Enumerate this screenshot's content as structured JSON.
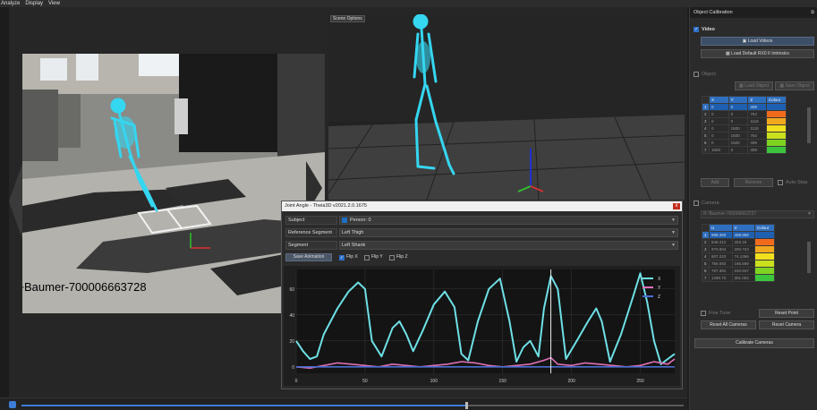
{
  "menu": [
    "Analyze",
    "Display",
    "View"
  ],
  "scene": {
    "options_label": "Scene Options"
  },
  "video": {
    "camera_overlay": "R~Baumer-700006663728"
  },
  "dialog": {
    "title": "Joint Angle - Theia3D v2021.2.0.1675",
    "close": "x",
    "subject_label": "Subject",
    "subject_value": "Person: 0",
    "ref_label": "Reference Segment",
    "ref_value": "Left Thigh",
    "segment_label": "Segment",
    "segment_value": "Left Shank",
    "save_animation": "Save Animation",
    "flip_x": "Flip X",
    "flip_y": "Flip Y",
    "flip_z": "Flip Z"
  },
  "chart_data": {
    "type": "line",
    "xlim": [
      0,
      275
    ],
    "ylim": [
      -5,
      75
    ],
    "xticks": [
      0,
      50,
      100,
      150,
      200,
      250
    ],
    "yticks": [
      0,
      20,
      40,
      60
    ],
    "vline_x": 185,
    "legend_position": "top-right",
    "series": [
      {
        "name": "X",
        "color": "#6ee0e6",
        "x": [
          0,
          5,
          10,
          15,
          20,
          30,
          38,
          45,
          50,
          55,
          62,
          70,
          75,
          80,
          85,
          92,
          100,
          108,
          115,
          120,
          125,
          132,
          140,
          148,
          155,
          160,
          165,
          170,
          176,
          180,
          185,
          190,
          196,
          205,
          212,
          218,
          222,
          228,
          236,
          245,
          250,
          255,
          260,
          265,
          270,
          275
        ],
        "y": [
          20,
          12,
          6,
          8,
          25,
          45,
          58,
          65,
          60,
          20,
          8,
          30,
          35,
          25,
          12,
          28,
          48,
          58,
          46,
          10,
          5,
          35,
          60,
          68,
          35,
          4,
          15,
          20,
          8,
          45,
          70,
          60,
          6,
          22,
          35,
          45,
          35,
          4,
          25,
          55,
          72,
          50,
          20,
          2,
          6,
          10
        ]
      },
      {
        "name": "Y",
        "color": "#e070b8",
        "x": [
          0,
          10,
          20,
          30,
          40,
          50,
          60,
          70,
          80,
          90,
          100,
          110,
          120,
          130,
          140,
          150,
          160,
          170,
          180,
          185,
          190,
          200,
          210,
          220,
          230,
          240,
          250,
          260,
          270,
          275
        ],
        "y": [
          0,
          -1,
          1,
          3,
          2,
          1,
          0,
          2,
          1,
          0,
          1,
          2,
          4,
          3,
          1,
          0,
          1,
          2,
          5,
          7,
          2,
          1,
          3,
          2,
          1,
          0,
          1,
          4,
          2,
          6
        ]
      },
      {
        "name": "Z",
        "color": "#4a6fd0",
        "x": [
          0,
          25,
          50,
          75,
          100,
          125,
          150,
          175,
          200,
          225,
          250,
          275
        ],
        "y": [
          0,
          0,
          0,
          0,
          0,
          0,
          0,
          0,
          0,
          0,
          0,
          0
        ]
      }
    ]
  },
  "panel": {
    "title": "Object Calibration",
    "video_label": "Video",
    "load_videos": "Load Videos",
    "load_intrinsics": "Load Default RX0 II Intrinsics",
    "object_label": "Object",
    "load_object": "Load Object",
    "save_object": "Save Object",
    "object_headers": [
      "X",
      "Y",
      "Z",
      "Colour"
    ],
    "object_rows": [
      {
        "n": "1",
        "x": "0",
        "y": "0",
        "z": "409",
        "colour": "#1f5fb0"
      },
      {
        "n": "2",
        "x": "0",
        "y": "0",
        "z": "764",
        "colour": "#f26b1d"
      },
      {
        "n": "3",
        "x": "0",
        "y": "0",
        "z": "1118",
        "colour": "#f2a81d"
      },
      {
        "n": "4",
        "x": "0",
        "y": "1500",
        "z": "1118",
        "colour": "#f2e01d"
      },
      {
        "n": "5",
        "x": "0",
        "y": "1500",
        "z": "764",
        "colour": "#c9e01d"
      },
      {
        "n": "6",
        "x": "0",
        "y": "1500",
        "z": "409",
        "colour": "#7ed321"
      },
      {
        "n": "7",
        "x": "1500",
        "y": "0",
        "z": "409",
        "colour": "#3cc43c"
      }
    ],
    "add": "Add",
    "remove": "Remove",
    "auto_step": "Auto-Step",
    "camera_label": "Camera",
    "camera_select": "R~Baumer-700006663727",
    "camera_headers": [
      "U",
      "V",
      "Colour"
    ],
    "camera_rows": [
      {
        "n": "1",
        "u": "988.360",
        "v": "408.858",
        "colour": "#1f5fb0"
      },
      {
        "n": "2",
        "u": "849.412",
        "v": "253.18",
        "colour": "#f26b1d"
      },
      {
        "n": "3",
        "u": "970.004",
        "v": "200.723",
        "colour": "#f2a81d"
      },
      {
        "n": "4",
        "u": "807.223",
        "v": "74.1366",
        "colour": "#f2e01d"
      },
      {
        "n": "5",
        "u": "756.692",
        "v": "165.569",
        "colour": "#c9e01d"
      },
      {
        "n": "6",
        "u": "787.391",
        "v": "240.947",
        "colour": "#7ed321"
      },
      {
        "n": "7",
        "u": "1290.72",
        "v": "301.004",
        "colour": "#3cc43c"
      }
    ],
    "fine_tune": "Fine Tune",
    "reset_point": "Reset Point",
    "reset_all_cameras": "Reset All Cameras",
    "reset_camera": "Reset Camera",
    "calibrate_cameras": "Calibrate Cameras"
  },
  "timeline": {
    "progress": 0.67
  }
}
